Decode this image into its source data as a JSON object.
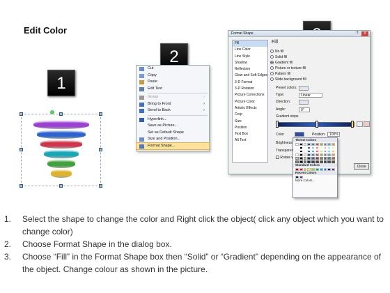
{
  "page": {
    "title": "Edit Color"
  },
  "badges": [
    "1",
    "2",
    "3"
  ],
  "context_menu": {
    "items": [
      {
        "label": "Cut",
        "icon": "scissors-icon",
        "enabled": true
      },
      {
        "label": "Copy",
        "icon": "copy-icon",
        "enabled": true
      },
      {
        "label": "Paste",
        "icon": "paste-icon",
        "enabled": true
      },
      {
        "label": "Edit Text",
        "icon": "edit-text-icon",
        "enabled": true
      },
      {
        "label": "Group",
        "icon": "group-icon",
        "enabled": false,
        "submenu": true
      },
      {
        "label": "Bring to Front",
        "icon": "bring-front-icon",
        "enabled": true,
        "submenu": true
      },
      {
        "label": "Send to Back",
        "icon": "send-back-icon",
        "enabled": true,
        "submenu": true
      },
      {
        "label": "Hyperlink...",
        "icon": "hyperlink-icon",
        "enabled": true
      },
      {
        "label": "Save as Picture...",
        "icon": "",
        "enabled": true
      },
      {
        "label": "Set as Default Shape",
        "icon": "",
        "enabled": true
      },
      {
        "label": "Size and Position...",
        "icon": "size-icon",
        "enabled": true
      },
      {
        "label": "Format Shape...",
        "icon": "format-shape-icon",
        "enabled": true,
        "highlighted": true
      }
    ]
  },
  "dialog": {
    "title": "Format Shape",
    "close": "X",
    "help": "?",
    "categories": [
      "Fill",
      "Line Color",
      "Line Style",
      "Shadow",
      "Reflection",
      "Glow and Soft Edges",
      "3-D Format",
      "3-D Rotation",
      "Picture Corrections",
      "Picture Color",
      "Artistic Effects",
      "Crop",
      "Size",
      "Position",
      "Text Box",
      "Alt Text"
    ],
    "selected_category": "Fill",
    "fill_heading": "Fill",
    "fill_options": [
      "No fill",
      "Solid fill",
      "Gradient fill",
      "Picture or texture fill",
      "Pattern fill",
      "Slide background fill"
    ],
    "fill_selected": "Gradient fill",
    "preset_label": "Preset colors:",
    "type_label": "Type:",
    "type_value": "Linear",
    "direction_label": "Direction:",
    "angle_label": "Angle:",
    "angle_value": "0°",
    "stops_label": "Gradient stops",
    "color_label": "Color",
    "position_label": "Position:",
    "position_value": "100%",
    "brightness_label": "Brightness",
    "transparency_label": "Transparency",
    "rotate_label": "Rotate w",
    "close_label": "Close"
  },
  "palette": {
    "theme_heading": "Theme Colors",
    "standard_heading": "Standard Colors",
    "recent_heading": "Recent Colors",
    "more_label": "More Colors...",
    "theme_top": [
      "#ffffff",
      "#000000",
      "#eeece1",
      "#1f497d",
      "#4f81bd",
      "#c0504d",
      "#9bbb59",
      "#8064a2",
      "#4bacc6",
      "#f79646"
    ],
    "standard": [
      "#c00000",
      "#ff0000",
      "#ffc000",
      "#ffff00",
      "#92d050",
      "#00b050",
      "#00b0f0",
      "#0070c0",
      "#002060",
      "#7030a0"
    ],
    "recent": [
      "#0a1f5c",
      "#7030a0"
    ]
  },
  "funnel": {
    "tiers": [
      {
        "color": "#9b3fd6"
      },
      {
        "color": "#2c63d0"
      },
      {
        "color": "#d0334a"
      },
      {
        "color": "#17a8b8"
      },
      {
        "color": "#3fa13a"
      },
      {
        "color": "#e0b32a"
      }
    ]
  },
  "steps": [
    {
      "num": "1.",
      "text": "Select the shape to change the color and Right click the object( click any object which you want to change color)"
    },
    {
      "num": "2.",
      "text": "Choose Format Shape in the dialog box."
    },
    {
      "num": "3.",
      "text": "Choose “Fill” in the Format Shape box then “Solid” or “Gradient” depending on the appearance of the object. Change colour as shown in the picture."
    }
  ]
}
